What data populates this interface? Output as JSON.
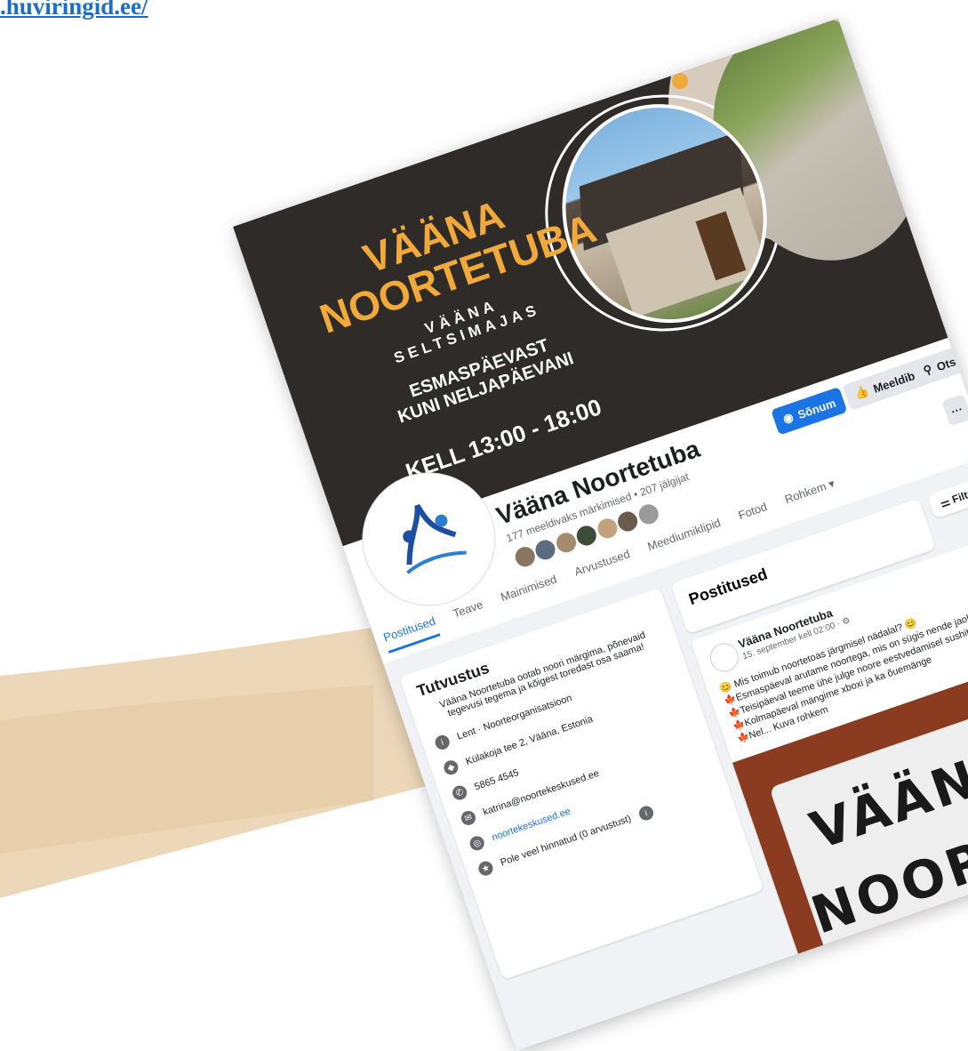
{
  "page_url": ".huviringid.ee/",
  "cover": {
    "title_line1": "VÄÄNA",
    "title_line2": "NOORTETUBA",
    "venue_line1": "VÄÄNA",
    "venue_line2": "SELTSIMAJAS",
    "days_line1": "ESMASPÄEVAST",
    "days_line2": "KUNI NELJAPÄEVANI",
    "time": "KELL 13:00 - 18:00",
    "accent_color": "#f0a93a"
  },
  "page": {
    "name": "Vääna Noortetuba",
    "stats": "177 meeldivaks märkimised • 207 jälgijat"
  },
  "actions": {
    "message": "Sõnum",
    "like": "Meeldib",
    "search": "Otsi",
    "more": "···"
  },
  "tabs": [
    "Postitused",
    "Teave",
    "Mainimised",
    "Arvustused",
    "Meediumiklipid",
    "Fotod",
    "Rohkem ▾"
  ],
  "intro": {
    "title": "Tutvustus",
    "description": "Vääna Noortetuba ootab noori märgima, põnevaid tegevusi tegema ja kõigest toredast osa saama!",
    "items": [
      {
        "icon": "info-icon",
        "text": "Lent · Noorteorganisatsioon"
      },
      {
        "icon": "location-icon",
        "text": "Külakoja tee 2, Vääna, Estonia"
      },
      {
        "icon": "phone-icon",
        "text": "5865 4545"
      },
      {
        "icon": "email-icon",
        "text": "katrina@noortekeskused.ee"
      },
      {
        "icon": "globe-icon",
        "text": "noortekeskused.ee",
        "link": true
      },
      {
        "icon": "star-icon",
        "text": "Pole veel hinnatud (0 arvustust)"
      }
    ]
  },
  "filters_label": "Filtrid",
  "posts_header": "Postitused",
  "post": {
    "author": "Vääna Noortetuba",
    "date": "15. september kell 02:00 · ⚙",
    "lines": [
      "😊 Mis toimub noortetoas järgmisel nädalal? 😊",
      "🍁Esmaspäeval arutame noortega, mis on sügis nende jaoks ja üritame seda purki mahutada",
      "🍁Teisipäeval teeme ühe julge noore eestvedamisel sushit",
      "🍁Kolmapäeval mängime xboxi ja ka õuemänge",
      "🍁Nel... Kuva rohkem"
    ],
    "sign_line1": "VÄÄNA",
    "sign_line2": "NOORTETUBA",
    "more": "···"
  }
}
